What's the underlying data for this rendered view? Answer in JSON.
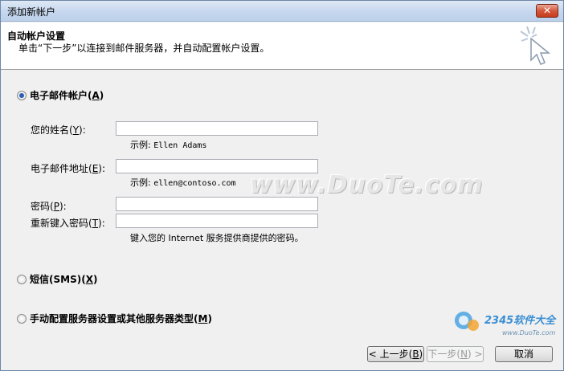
{
  "window": {
    "title": "添加新帐户",
    "close_label": "✕"
  },
  "header": {
    "title": "自动帐户设置",
    "description": "单击“下一步”以连接到邮件服务器，并自动配置帐户设置。"
  },
  "options": {
    "email": {
      "label": "电子邮件帐户(",
      "key": "A",
      "end": ")",
      "checked": true
    },
    "sms": {
      "label": "短信(SMS)(",
      "key": "X",
      "end": ")",
      "checked": false
    },
    "manual": {
      "label": "手动配置服务器设置或其他服务器类型(",
      "key": "M",
      "end": ")",
      "checked": false
    }
  },
  "form": {
    "name_label": "您的姓名(",
    "name_key": "Y",
    "name_end": "):",
    "name_value": "",
    "name_hint_prefix": "示例:",
    "name_hint": "Ellen Adams",
    "email_label": "电子邮件地址(",
    "email_key": "E",
    "email_end": "):",
    "email_value": "",
    "email_hint_prefix": "示例:",
    "email_hint": "ellen@contoso.com",
    "password_label": "密码(",
    "password_key": "P",
    "password_end": "):",
    "password_value": "",
    "retype_label": "重新键入密码(",
    "retype_key": "T",
    "retype_end": "):",
    "retype_value": "",
    "password_hint": "键入您的 Internet 服务提供商提供的密码。"
  },
  "buttons": {
    "back_label": "< 上一步(",
    "back_key": "B",
    "back_end": ")",
    "next_label": "下一步(",
    "next_key": "N",
    "next_end": ") >",
    "cancel_label": "取消"
  },
  "watermark": "www.DuoTe.com",
  "logo": {
    "text": "2345软件大全",
    "url": "www.DuoTe.com"
  },
  "colors": {
    "titlebar": "#c7d8ee",
    "close": "#c73b1c",
    "radio_dot": "#2a5bb5"
  }
}
